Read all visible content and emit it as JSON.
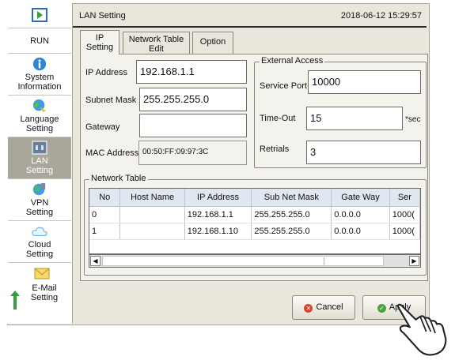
{
  "header": {
    "title": "LAN Setting",
    "datetime": "2018-06-12  15:29:57"
  },
  "sidebar": {
    "items": [
      {
        "label": "",
        "icon": "play-icon"
      },
      {
        "label": "RUN",
        "icon": ""
      },
      {
        "label": "System\nInformation",
        "icon": "info-icon"
      },
      {
        "label": "Language\nSetting",
        "icon": "globe-icon"
      },
      {
        "label": "LAN\nSetting",
        "icon": "lan-icon"
      },
      {
        "label": "VPN\nSetting",
        "icon": "vpn-icon"
      },
      {
        "label": "Cloud\nSetting",
        "icon": "cloud-icon"
      },
      {
        "label": "E-Mail\nSetting",
        "icon": "mail-icon"
      }
    ]
  },
  "tabs": [
    {
      "label": "IP\nSetting"
    },
    {
      "label": "Network Table\nEdit"
    },
    {
      "label": "Option"
    }
  ],
  "ip": {
    "ip_label": "IP Address",
    "ip_value": "192.168.1.1",
    "mask_label": "Subnet Mask",
    "mask_value": "255.255.255.0",
    "gw_label": "Gateway",
    "gw_value": "",
    "mac_label": "MAC Address",
    "mac_value": "00:50:FF:09:97:3C"
  },
  "external": {
    "title": "External Access",
    "port_label": "Service Port",
    "port_value": "10000",
    "timeout_label": "Time-Out",
    "timeout_value": "15",
    "timeout_unit": "*sec",
    "retrials_label": "Retrials",
    "retrials_value": "3"
  },
  "network_table": {
    "title": "Network Table",
    "columns": [
      "No",
      "Host Name",
      "IP Address",
      "Sub Net Mask",
      "Gate Way",
      "Ser"
    ],
    "rows": [
      [
        "0",
        "",
        "192.168.1.1",
        "255.255.255.0",
        "0.0.0.0",
        "1000("
      ],
      [
        "1",
        "",
        "192.168.1.10",
        "255.255.255.0",
        "0.0.0.0",
        "1000("
      ]
    ]
  },
  "actions": {
    "cancel": "Cancel",
    "apply": "Apply"
  },
  "colors": {
    "cancel_icon": "#d9452b",
    "apply_icon": "#4ba53c",
    "active_sidebar": "#a9a69c"
  }
}
